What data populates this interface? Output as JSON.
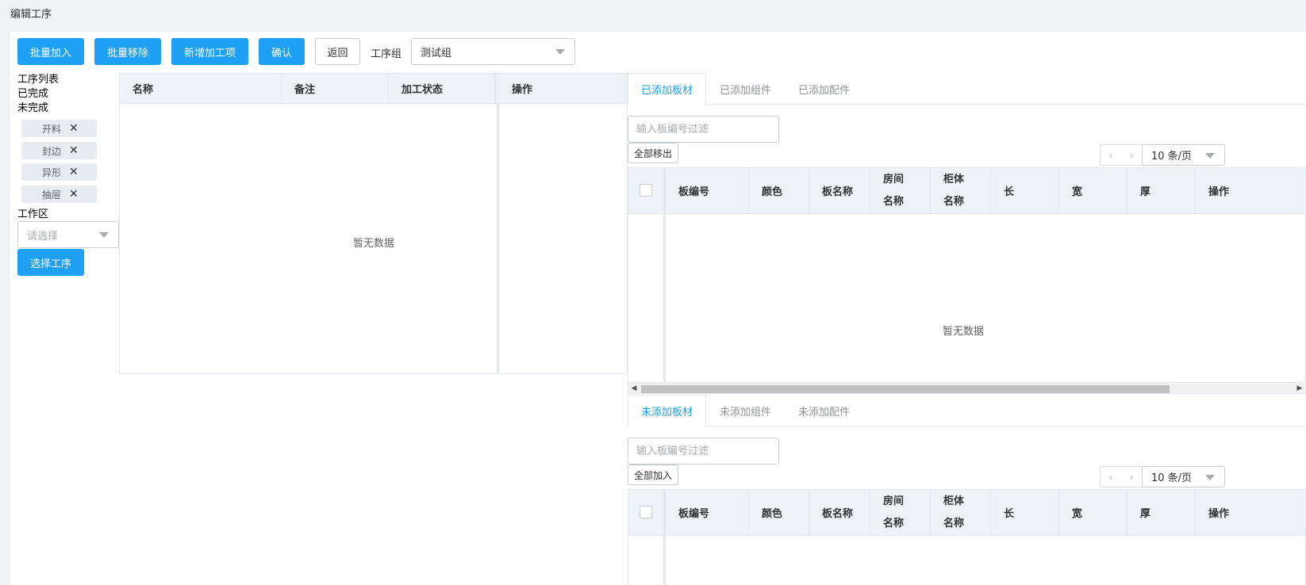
{
  "page": {
    "title": "编辑工序"
  },
  "toolbar": {
    "batch_add": "批量加入",
    "batch_remove": "批量移除",
    "add_process_item": "新增加工项",
    "confirm": "确认",
    "back": "返回",
    "group_label": "工序组",
    "group_value": "测试组"
  },
  "left": {
    "process_list": "工序列表",
    "done": "已完成",
    "undone": "未完成",
    "tags": [
      "开料",
      "封边",
      "异形",
      "抽屉"
    ],
    "work_area_label": "工作区",
    "work_area_placeholder": "请选择",
    "select_process": "选择工序"
  },
  "process_table": {
    "columns": [
      "名称",
      "备注",
      "加工状态",
      "操作"
    ],
    "empty": "暂无数据"
  },
  "top_section": {
    "tabs": [
      "已添加板材",
      "已添加组件",
      "已添加配件"
    ],
    "filter_placeholder": "输入板编号过滤",
    "bulk_button": "全部移出",
    "page_size": "10 条/页",
    "columns": [
      "板编号",
      "颜色",
      "板名称",
      "房间名称",
      "柜体名称",
      "长",
      "宽",
      "厚",
      "操作"
    ],
    "empty": "暂无数据"
  },
  "bottom_section": {
    "tabs": [
      "未添加板材",
      "未添加组件",
      "未添加配件"
    ],
    "filter_placeholder": "输入板编号过滤",
    "bulk_button": "全部加入",
    "page_size": "10 条/页",
    "columns": [
      "板编号",
      "颜色",
      "板名称",
      "房间名称",
      "柜体名称",
      "长",
      "宽",
      "厚",
      "操作"
    ]
  },
  "colors": {
    "primary": "#1ea0f5",
    "header_bg": "#eef1f6",
    "page_bg": "#f0f2f5"
  }
}
